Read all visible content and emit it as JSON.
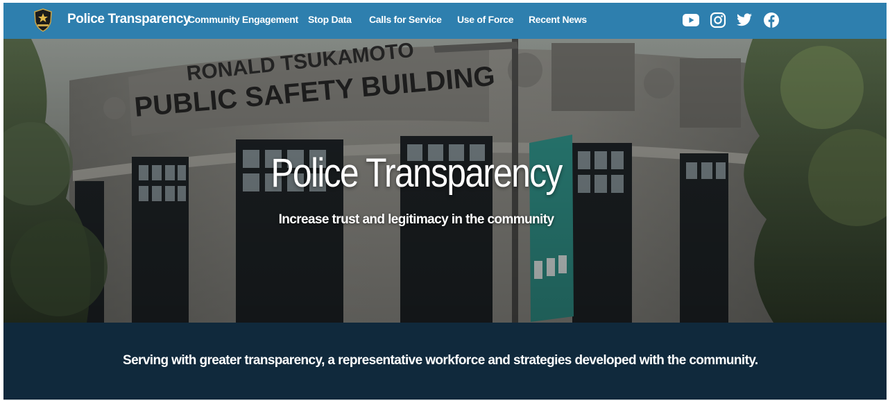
{
  "header": {
    "brand": "Police Transparency",
    "nav": [
      {
        "label": "Community Engagement"
      },
      {
        "label": "Stop Data"
      },
      {
        "label": "Calls for Service"
      },
      {
        "label": "Use of Force"
      },
      {
        "label": "Recent News"
      }
    ],
    "social_icons": [
      "youtube-icon",
      "instagram-icon",
      "twitter-icon",
      "facebook-icon"
    ],
    "colors": {
      "nav_bg": "#2e7fae",
      "text": "#ffffff"
    }
  },
  "hero": {
    "title": "Police Transparency",
    "subtitle": "Increase trust and legitimacy in the community",
    "building_sign": {
      "line1": "RONALD TSUKAMOTO",
      "line2": "PUBLIC SAFETY BUILDING"
    }
  },
  "band": {
    "text": "Serving with greater transparency, a representative workforce and strategies developed with the community.",
    "color": "#10293c"
  }
}
